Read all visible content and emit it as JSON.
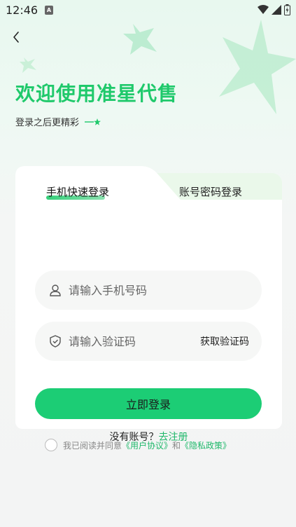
{
  "status_bar": {
    "time": "12:46",
    "notification_badge": "A",
    "icons": [
      "wifi-icon",
      "signal-icon",
      "battery-icon"
    ]
  },
  "header": {
    "back_icon": "chevron-left-icon",
    "title": "欢迎使用准星代售",
    "subtitle": "登录之后更精彩"
  },
  "tabs": {
    "active": "手机快速登录",
    "inactive": "账号密码登录"
  },
  "form": {
    "phone_placeholder": "请输入手机号码",
    "code_placeholder": "请输入验证码",
    "get_code_label": "获取验证码",
    "login_label": "立即登录"
  },
  "register": {
    "prompt": "没有账号？",
    "link": "去注册"
  },
  "agreement": {
    "prefix": "我已阅读并同意",
    "user_agreement": "《用户协议》",
    "and": "和",
    "privacy_policy": "《隐私政策》"
  },
  "colors": {
    "brand_green": "#1fc96b",
    "button_green": "#1ccd75",
    "link_green": "#1fb86a"
  }
}
